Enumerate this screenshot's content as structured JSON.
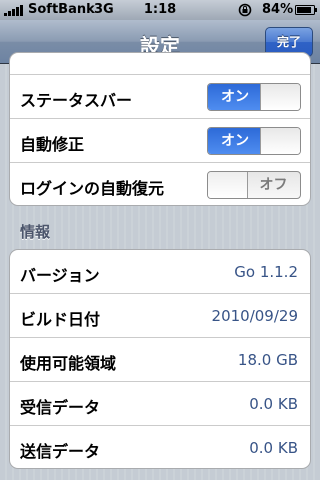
{
  "status_bar": {
    "carrier": "SoftBank",
    "network": "3G",
    "time": "1:18",
    "battery": "84%",
    "icons": [
      "signal-bars-icon",
      "rotation-lock-icon",
      "battery-icon"
    ]
  },
  "nav": {
    "title": "設定",
    "done_label": "完了"
  },
  "toggles": [
    {
      "label": "ステータスバー",
      "state_text": "オン",
      "state": "on"
    },
    {
      "label": "自動修正",
      "state_text": "オン",
      "state": "on"
    },
    {
      "label": "ログインの自動復元",
      "state_text": "オフ",
      "state": "off"
    }
  ],
  "info": {
    "header": "情報",
    "rows": [
      {
        "label": "バージョン",
        "value": "Go 1.1.2"
      },
      {
        "label": "ビルド日付",
        "value": "2010/09/29"
      },
      {
        "label": "使用可能領域",
        "value": "18.0 GB"
      },
      {
        "label": "受信データ",
        "value": "0.0 KB"
      },
      {
        "label": "送信データ",
        "value": "0.0 KB"
      }
    ]
  },
  "colors": {
    "nav_bar": "#6d83a2",
    "done_button": "#2f62c6",
    "switch_on": "#2d6ad8",
    "value_text": "#385487",
    "background": "#c5ccd4"
  }
}
